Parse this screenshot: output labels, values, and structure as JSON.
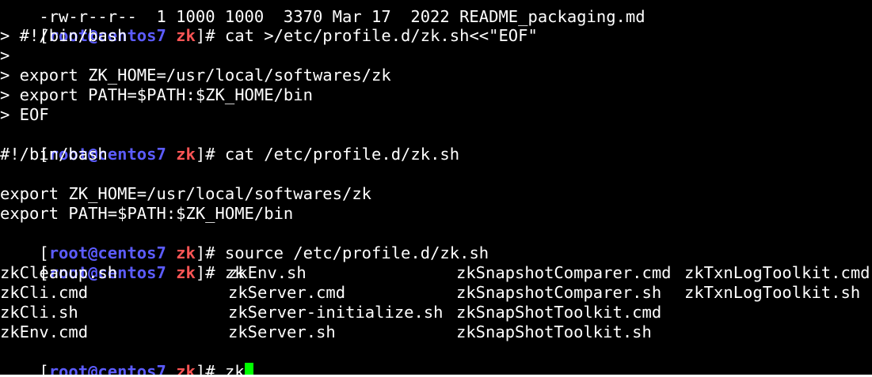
{
  "terminal": {
    "top_partial": "-rw-r--r--  1 1000 1000  3370 Mar 17  2022 README_packaging.md",
    "prompt": {
      "bracket_open": "[",
      "user_host": "root@centos7",
      "space": " ",
      "dir": "zk",
      "bracket_close": "]#"
    },
    "commands": {
      "c1": " cat >/etc/profile.d/zk.sh<<\"EOF\"",
      "c2": " cat /etc/profile.d/zk.sh",
      "c3": " source /etc/profile.d/zk.sh",
      "c4": " zk",
      "c5": " zk"
    },
    "heredoc": [
      "> #!/bin/bash",
      ">",
      "> export ZK_HOME=/usr/local/softwares/zk",
      "> export PATH=$PATH:$ZK_HOME/bin",
      "> EOF"
    ],
    "cat_output": [
      "#!/bin/bash",
      "",
      "export ZK_HOME=/usr/local/softwares/zk",
      "export PATH=$PATH:$ZK_HOME/bin"
    ],
    "completions": [
      [
        "zkCleanup.sh",
        "zkEnv.sh",
        "zkSnapshotComparer.cmd",
        "zkTxnLogToolkit.cmd"
      ],
      [
        "zkCli.cmd",
        "zkServer.cmd",
        "zkSnapshotComparer.sh",
        "zkTxnLogToolkit.sh"
      ],
      [
        "zkCli.sh",
        "zkServer-initialize.sh",
        "zkSnapShotToolkit.cmd",
        ""
      ],
      [
        "zkEnv.cmd",
        "zkServer.sh",
        "zkSnapShotToolkit.sh",
        ""
      ]
    ],
    "colors": {
      "background": "#000000",
      "foreground": "#ffffff",
      "user_host": "#5c5cff",
      "dir": "#ff5555",
      "cursor": "#00ff00"
    }
  }
}
